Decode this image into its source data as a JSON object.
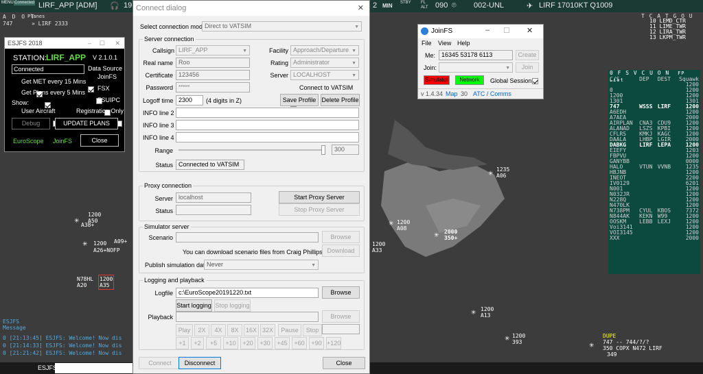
{
  "topbar": {
    "menu_label": "MENU",
    "connected_label": "Connected",
    "title": "LIRF_APP [ADM]",
    "freq": "19",
    "num": "2",
    "min_label": "MIN",
    "stby_label": "STBY",
    "fl_label": "FL",
    "alt_label": "ALT",
    "alt_val": "090",
    "sector": "002-UNL",
    "metar": "LIRF 17010KT Q1009",
    "left_tabs": "A D O T",
    "planes_label": "Planes",
    "plane_count": "747",
    "plane_route": "» LIRF 2333",
    "right_tabs": "T C A T G O U"
  },
  "ctr_list": [
    "10 LEMD_CTR",
    "11 LIME_TWR",
    "12 LIRA_TWR",
    "13 LKPM_TWR"
  ],
  "fpl": {
    "tabs": "0 F S V C U O N",
    "title": "FP List",
    "headers": [
      "C/S",
      "DEP",
      "DEST",
      "Squawk"
    ],
    "rows": [
      [
        "",
        "",
        "",
        "1200",
        false
      ],
      [
        "0",
        "",
        "",
        "1200",
        false
      ],
      [
        "1200",
        "",
        "",
        "1200",
        false
      ],
      [
        "1301",
        "",
        "",
        "1301",
        false
      ],
      [
        "747",
        "WSSS",
        "LIRF",
        "1200",
        true
      ],
      [
        "A6EDH",
        "",
        "",
        "1200",
        false
      ],
      [
        "A7AEA",
        "",
        "",
        "2000",
        false
      ],
      [
        "AIRPLAN",
        "CNA3",
        "CDU9",
        "1200",
        false
      ],
      [
        "ALANAD",
        "LSZS",
        "KPBI",
        "1200",
        false
      ],
      [
        "CFLRS",
        "KMKJ",
        "KAGC",
        "1200",
        false
      ],
      [
        "DAALA",
        "LHBP",
        "LGIR",
        "2000",
        false
      ],
      [
        "DABKG",
        "LIRF",
        "LEPA",
        "1200",
        true
      ],
      [
        "EIEFY",
        "",
        "",
        "1203",
        false
      ],
      [
        "FBPVU",
        "",
        "",
        "1200",
        false
      ],
      [
        "GANYBB",
        "",
        "",
        "0000",
        false
      ],
      [
        "HALO",
        "VTUN",
        "VVNB",
        "1235",
        false
      ],
      [
        "HBJNB",
        "",
        "",
        "1200",
        false
      ],
      [
        "INEOT",
        "",
        "",
        "2200",
        false
      ],
      [
        "IV0129",
        "",
        "",
        "6201",
        false
      ],
      [
        "N001",
        "",
        "",
        "1200",
        false
      ],
      [
        "N032JR",
        "",
        "",
        "1200",
        false
      ],
      [
        "N228Q",
        "",
        "",
        "1200",
        false
      ],
      [
        "N470LK",
        "",
        "",
        "1200",
        false
      ],
      [
        "N738PM",
        "CYUL",
        "KBOS",
        "7372",
        false
      ],
      [
        "N844AK",
        "KEKN",
        "W99",
        "1200",
        false
      ],
      [
        "OOSKM",
        "LEBB",
        "LEXJ",
        "1200",
        false
      ],
      [
        "Voi3141",
        "",
        "",
        "1200",
        false
      ],
      [
        "VOI3145",
        "",
        "",
        "1200",
        false
      ],
      [
        "XXX",
        "",
        "",
        "2000",
        false
      ]
    ]
  },
  "radar": {
    "targets": [
      {
        "c": "1200",
        "s": "A50",
        "l": "A38+"
      },
      {
        "c": "1200",
        "s": "A09+",
        "l": "A26+NOFP"
      },
      {
        "c": "N78HL",
        "s": "A20"
      },
      {
        "c": "1200",
        "s": "A35"
      },
      {
        "c": "1235",
        "s": "A06"
      },
      {
        "c": "1200",
        "s": "A08"
      },
      {
        "c": "2000",
        "s": "350+"
      },
      {
        "c": "1200",
        "s": "A33"
      },
      {
        "c": "1200",
        "s": "A13"
      },
      {
        "c": "1200",
        "s": "393"
      }
    ],
    "dupe": {
      "l1": "DUPE",
      "l2": "747 -- 744/?/?",
      "l3": "350 COPX N472 LIRF",
      "l4": "349"
    }
  },
  "msg": {
    "title": "ESJFS",
    "sub": "Message",
    "lines": [
      "0 [21:13:45] ESJFS: Welcome! Now dis",
      "0 [21:14:33] ESJFS: Welcome! Now dis",
      "0 [21:21:42] ESJFS: Welcome! Now dis"
    ],
    "cmd": "ESJFS"
  },
  "esjfs": {
    "title": "ESJFS 2018",
    "station_label": "STATION:",
    "station": "LIRF_APP",
    "version": "V 2.1.0.1",
    "status": "Connected",
    "data_source": "Data Source",
    "met": "Get MET every 15 Mins",
    "plans": "Get Plans every 5 Mins",
    "show": "Show:",
    "user_aircraft": "User Aircraft",
    "reg_only": "Registration Only",
    "joinfs": "JoinFS",
    "fsx": "FSX",
    "fsuipc": "FSUIPC",
    "debug": "Debug",
    "update": "UPDATE PLANS",
    "euroscope": "EuroScope",
    "joinfs_link": "JoinFS",
    "close": "Close"
  },
  "dlg": {
    "title": "Connect dialog",
    "mode_label": "Select connection mode:",
    "mode": "Direct to VATSIM",
    "server_conn": "Server connection",
    "callsign_label": "Callsign",
    "callsign": "LIRF_APP",
    "realname_label": "Real name",
    "realname": "Roo",
    "cert_label": "Certificate",
    "cert": "123456",
    "pw_label": "Password",
    "pw": "******",
    "logoff_label": "Logoff time",
    "logoff": "2300",
    "logoff_hint": "(4 digits in Z)",
    "facility_label": "Facility",
    "facility": "Approach/Departure",
    "rating_label": "Rating",
    "rating": "Administrator",
    "server_label": "Server",
    "server": "LOCALHOST",
    "connect_vatsim": "Connect to VATSIM",
    "save_profile": "Save Profile",
    "delete_profile": "Delete Profile",
    "info2": "INFO line 2",
    "info3": "INFO line 3",
    "info4": "INFO line 4",
    "range_label": "Range",
    "range": "300",
    "status_label": "Status",
    "status": "Connected to VATSIM",
    "proxy": "Proxy connection",
    "proxy_server_label": "Server",
    "proxy_server": "localhost",
    "proxy_status_label": "Status",
    "start_proxy": "Start Proxy Server",
    "stop_proxy": "Stop Proxy Server",
    "sim": "Simulator server",
    "scenario_label": "Scenario",
    "browse": "Browse",
    "download_note": "You can download scenario files from Craig Phillips' ASE site",
    "download": "Download",
    "publish_label": "Publish simulation data:",
    "publish": "Never",
    "logging": "Logging and playback",
    "logfile_label": "Logfile",
    "logfile": "c:\\EuroScope20191220.txt",
    "start_log": "Start logging",
    "stop_log": "Stop logging",
    "playback_label": "Playback",
    "play": [
      "Play",
      "2X",
      "4X",
      "8X",
      "16X",
      "32X",
      "Pause",
      "Stop"
    ],
    "jumps": [
      "+1",
      "+2",
      "+5",
      "+10",
      "+20",
      "+30",
      "+45",
      "+60",
      "+90",
      "+120"
    ],
    "connect": "Connect",
    "disconnect": "Disconnect",
    "close": "Close"
  },
  "jfs": {
    "title": "JoinFS",
    "menu": [
      "File",
      "View",
      "Help"
    ],
    "me_label": "Me:",
    "me": "16345 53178 6113",
    "create": "Create",
    "join_label": "Join:",
    "join_btn": "Join",
    "simulator": "Simulator",
    "network": "Network",
    "global": "Global Session",
    "version": "v 1.4.34",
    "map": "Map",
    "count": "30",
    "atc": "ATC / Comms"
  },
  "colors": {
    "radar_bg": "#3c3c3c",
    "topbar": "#1a3a33",
    "fpl_bg": "#0c4a3e",
    "sim_btn": "#ff0000",
    "net_btn": "#00ff00",
    "link": "#0066cc"
  }
}
